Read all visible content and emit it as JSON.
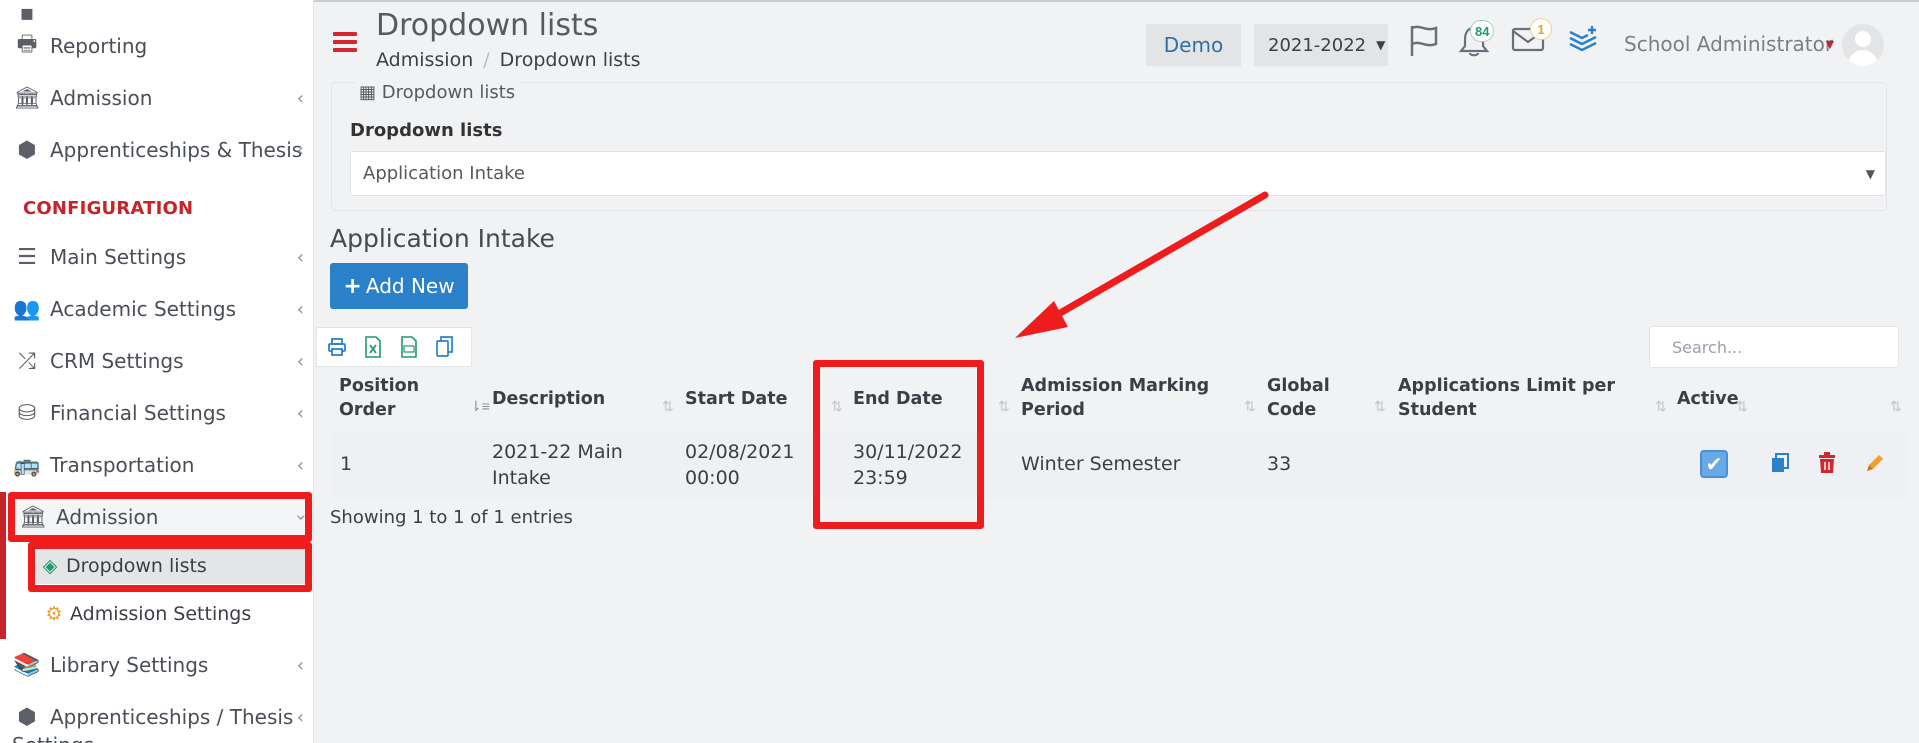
{
  "header": {
    "page_title": "Dropdown lists",
    "breadcrumb": [
      "Admission",
      "Dropdown lists"
    ],
    "demo_button": "Demo",
    "year_select": "2021-2022",
    "notifications_count": "84",
    "messages_count": "1",
    "user_name": "School Administrator"
  },
  "sidebar": {
    "items": [
      {
        "label": "Reporting",
        "icon": "printer-icon"
      },
      {
        "label": "Admission",
        "icon": "institution-icon"
      },
      {
        "label": "Apprenticeships & Thesis",
        "icon": "cube-icon"
      }
    ],
    "config_heading": "CONFIGURATION",
    "config_items": [
      {
        "label": "Main Settings",
        "icon": "sliders-icon"
      },
      {
        "label": "Academic Settings",
        "icon": "users-icon"
      },
      {
        "label": "CRM Settings",
        "icon": "shuffle-icon"
      },
      {
        "label": "Financial Settings",
        "icon": "coins-icon"
      },
      {
        "label": "Transportation",
        "icon": "bus-icon"
      },
      {
        "label": "Admission",
        "icon": "institution-icon"
      }
    ],
    "sub_items": [
      {
        "label": "Dropdown lists",
        "icon": "layers-icon"
      },
      {
        "label": "Admission Settings",
        "icon": "gears-icon"
      }
    ],
    "bottom_items": [
      {
        "label": "Library Settings",
        "icon": "books-icon"
      },
      {
        "label": "Apprenticeships / Thesis",
        "icon": "cube-icon"
      }
    ],
    "bottom_item_overflow": "Settings"
  },
  "panel": {
    "legend": "Dropdown lists",
    "field_label": "Dropdown lists",
    "selected_value": "Application Intake"
  },
  "section": {
    "title": "Application Intake",
    "add_button": "Add New",
    "search_placeholder": "Search..."
  },
  "table": {
    "columns": [
      {
        "label": "Position Order"
      },
      {
        "label": "Description"
      },
      {
        "label": "Start Date"
      },
      {
        "label": "End Date"
      },
      {
        "label": "Admission Marking Period"
      },
      {
        "label": "Global Code"
      },
      {
        "label": "Applications Limit per Student"
      },
      {
        "label": "Active"
      }
    ],
    "rows": [
      {
        "position_order": "1",
        "description": "2021-22 Main Intake",
        "start_date": "02/08/2021 00:00",
        "end_date": "30/11/2022 23:59",
        "marking_period": "Winter Semester",
        "global_code": "33",
        "applications_limit": "",
        "active": true
      }
    ],
    "info": "Showing 1 to 1 of 1 entries"
  },
  "colors": {
    "accent_red": "#c5252a",
    "primary_blue": "#2a81c9",
    "annotation_red": "#ee1c1c"
  }
}
